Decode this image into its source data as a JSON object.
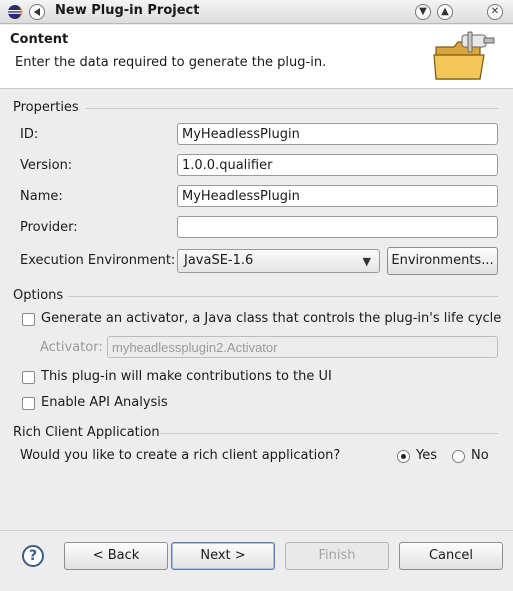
{
  "window": {
    "title": "New Plug-in Project"
  },
  "header": {
    "title": "Content",
    "description": "Enter the data required to generate the plug-in."
  },
  "properties": {
    "group_label": "Properties",
    "id_label": "ID:",
    "id_value": "MyHeadlessPlugin",
    "version_label": "Version:",
    "version_value": "1.0.0.qualifier",
    "name_label": "Name:",
    "name_value": "MyHeadlessPlugin",
    "provider_label": "Provider:",
    "provider_value": "",
    "exec_env_label": "Execution Environment:",
    "exec_env_value": "JavaSE-1.6",
    "environments_button": "Environments..."
  },
  "options": {
    "group_label": "Options",
    "activator_checkbox": "Generate an activator, a Java class that controls the plug-in's life cycle",
    "activator_label": "Activator:",
    "activator_value": "myheadlessplugin2.Activator",
    "ui_contrib_checkbox": "This plug-in will make contributions to the UI",
    "api_analysis_checkbox": "Enable API Analysis"
  },
  "rcp": {
    "group_label": "Rich Client Application",
    "question": "Would you like to create a rich client application?",
    "yes_label": "Yes",
    "no_label": "No",
    "selected": "Yes"
  },
  "footer": {
    "back": "< Back",
    "next": "Next >",
    "finish": "Finish",
    "cancel": "Cancel",
    "help": "?"
  }
}
